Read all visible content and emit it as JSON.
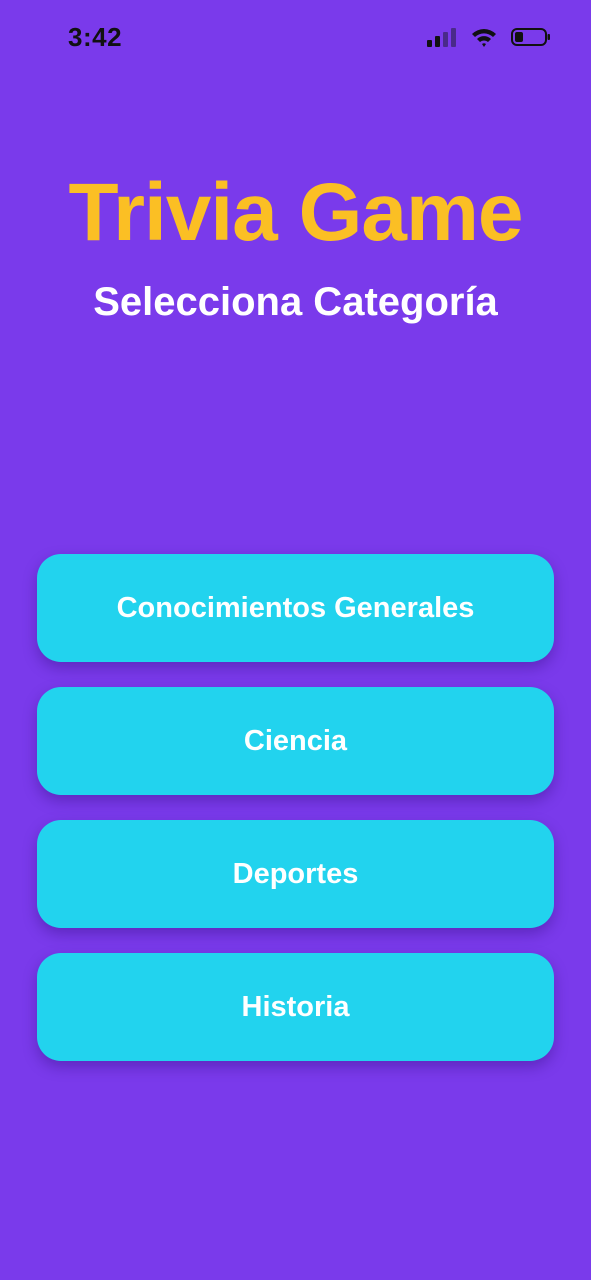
{
  "status_bar": {
    "time": "3:42",
    "icons": [
      "cellular-signal-icon",
      "wifi-icon",
      "battery-icon"
    ]
  },
  "header": {
    "title": "Trivia Game",
    "subtitle": "Selecciona Categoría"
  },
  "categories": [
    {
      "label": "Conocimientos Generales"
    },
    {
      "label": "Ciencia"
    },
    {
      "label": "Deportes"
    },
    {
      "label": "Historia"
    }
  ],
  "colors": {
    "background": "#7a3aeb",
    "title": "#fbbf24",
    "subtitle": "#ffffff",
    "button": "#22d3ee",
    "button_text": "#ffffff"
  }
}
